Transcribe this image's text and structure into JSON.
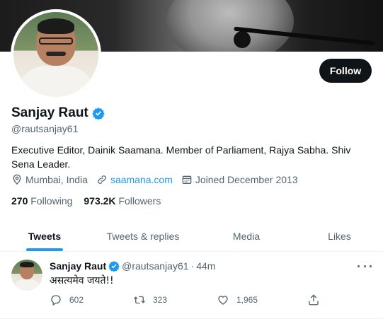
{
  "profile": {
    "name": "Sanjay Raut",
    "handle": "@rautsanjay61",
    "bio": "Executive Editor, Dainik Saamana. Member of Parliament, Rajya Sabha. Shiv Sena Leader.",
    "location": "Mumbai, India",
    "website": "saamana.com",
    "joined": "Joined December 2013",
    "following_count": "270",
    "following_label": "Following",
    "followers_count": "973.2K",
    "followers_label": "Followers",
    "follow_button": "Follow"
  },
  "tabs": [
    {
      "label": "Tweets",
      "active": true
    },
    {
      "label": "Tweets & replies",
      "active": false
    },
    {
      "label": "Media",
      "active": false
    },
    {
      "label": "Likes",
      "active": false
    }
  ],
  "tweet": {
    "name": "Sanjay Raut",
    "handle": "@rautsanjay61",
    "separator": "·",
    "time": "44m",
    "text": "असत्यमेव जयते!!",
    "replies": "602",
    "retweets": "323",
    "likes": "1,965"
  },
  "colors": {
    "accent": "#1d9bf0",
    "text_primary": "#0f1419",
    "text_secondary": "#536471",
    "follow_bg": "#0f1419"
  },
  "icons": {
    "verified": "verified-badge-icon",
    "location": "location-pin-icon",
    "link": "link-icon",
    "calendar": "calendar-icon",
    "more": "more-dots-icon",
    "reply": "reply-icon",
    "retweet": "retweet-icon",
    "like": "heart-icon",
    "share": "share-icon"
  }
}
